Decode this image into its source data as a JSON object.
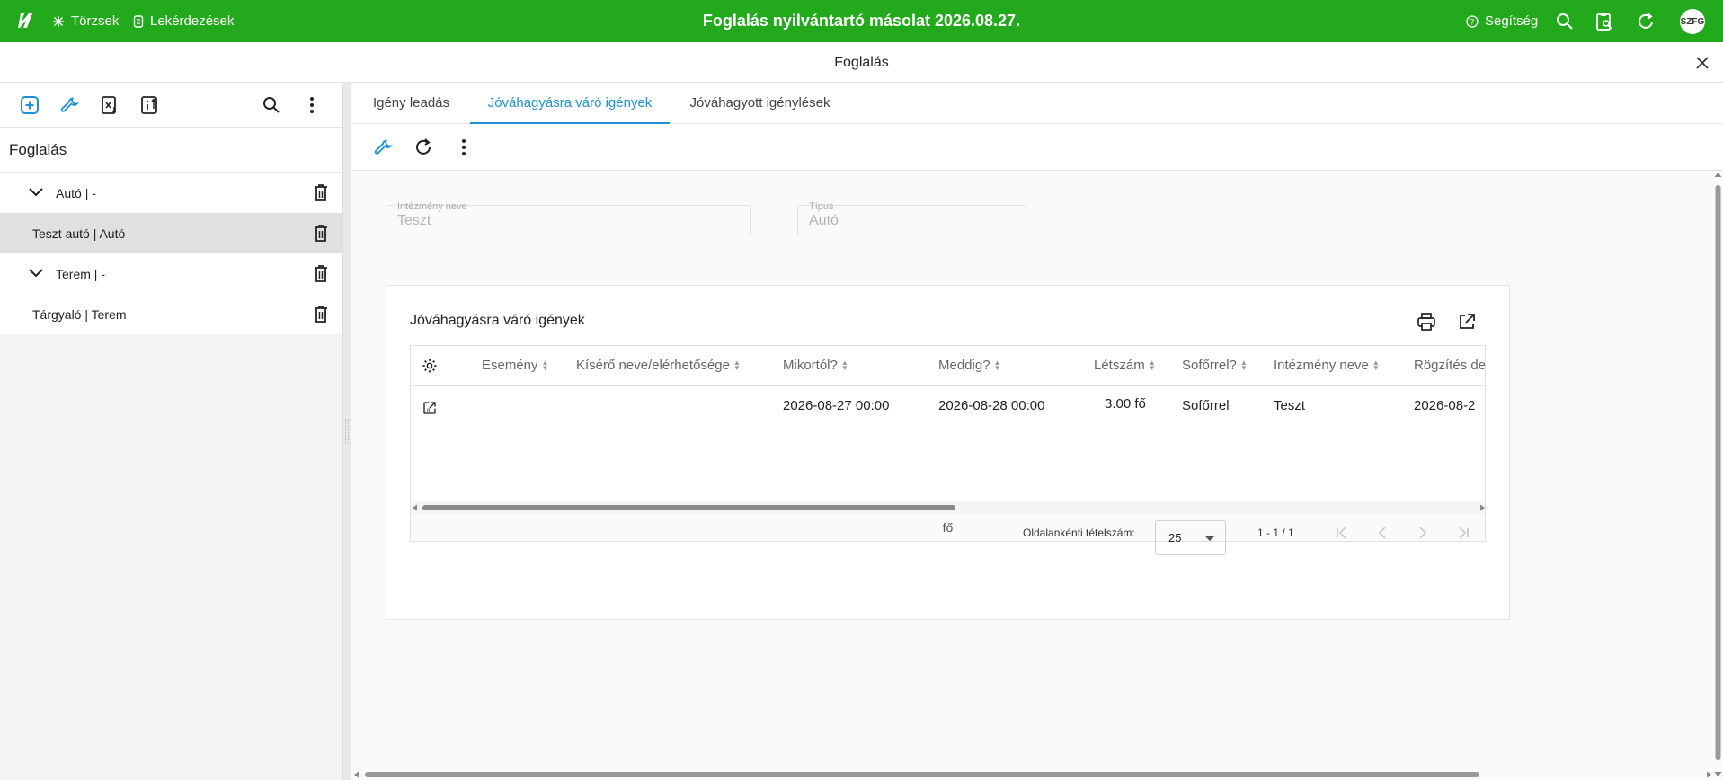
{
  "topbar": {
    "title": "Foglalás nyilvántartó másolat 2026.08.27.",
    "links": [
      {
        "label": "Törzsek",
        "icon": "snowflake-icon"
      },
      {
        "label": "Lekérdezések",
        "icon": "query-icon"
      }
    ],
    "help_label": "Segítség",
    "avatar": "SZFG",
    "accent": "#22a91c"
  },
  "window": {
    "title": "Foglalás"
  },
  "sidebar": {
    "header": "Foglalás",
    "items": [
      {
        "label": "Autó | -",
        "expandable": true,
        "selected": false
      },
      {
        "label": "Teszt autó | Autó",
        "expandable": false,
        "selected": true
      },
      {
        "label": "Terem | -",
        "expandable": true,
        "selected": false
      },
      {
        "label": "Tárgyaló | Terem",
        "expandable": false,
        "selected": false
      }
    ]
  },
  "tabs": [
    {
      "label": "Igény leadás",
      "active": false
    },
    {
      "label": "Jóváhagyásra váró igények",
      "active": true
    },
    {
      "label": "Jóváhagyott igénylések",
      "active": false
    }
  ],
  "filters": {
    "institution": {
      "label": "Intézmény neve",
      "value": "Teszt"
    },
    "type": {
      "label": "Típus",
      "value": "Autó"
    }
  },
  "card": {
    "title": "Jóváhagyásra váró igények",
    "columns": [
      "Esemény",
      "Kísérő neve/elérhetősége",
      "Mikortól?",
      "Meddig?",
      "Létszám",
      "Sofőrrel?",
      "Intézmény neve",
      "Rögzítés de"
    ],
    "rows": [
      {
        "event": "",
        "escort": "",
        "from": "2026-08-27 00:00",
        "to": "2026-08-28 00:00",
        "count": "3.00 fő",
        "driver": "Sofőrrel",
        "institution": "Teszt",
        "recorded": "2026-08-2"
      }
    ],
    "footer_sum": "fő"
  },
  "pager": {
    "per_page_label": "Oldalankénti tételszám:",
    "per_page_value": "25",
    "range": "1 - 1 / 1"
  }
}
